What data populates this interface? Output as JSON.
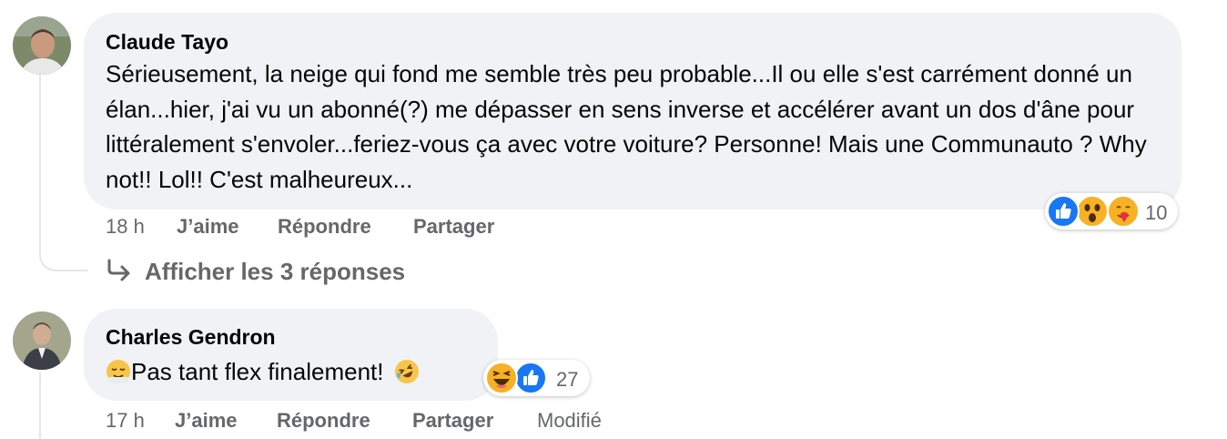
{
  "comments": [
    {
      "author": "Claude Tayo",
      "text": "Sérieusement, la neige qui fond me semble très peu probable...Il ou elle s'est carrément donné un élan...hier, j'ai vu un abonné(?) me dépasser en sens inverse et accélérer avant un dos d'âne pour littéralement s'envoler...feriez-vous ça avec votre voiture? Personne! Mais une Communauto ? Why not!! Lol!! C'est malheureux...",
      "time": "18 h",
      "like_label": "J’aime",
      "reply_label": "Répondre",
      "share_label": "Partager",
      "reactions": {
        "icons": [
          "like",
          "wow",
          "care"
        ],
        "count": "10"
      },
      "view_replies_label": "Afficher les 3 réponses"
    },
    {
      "author": "Charles Gendron",
      "text": "Pas tant flex finalement!",
      "emoji_before": "relieved-face-emoji",
      "emoji_after": "rolling-laughing-emoji",
      "time": "17 h",
      "like_label": "J’aime",
      "reply_label": "Répondre",
      "share_label": "Partager",
      "edited_label": "Modifié",
      "reactions": {
        "icons": [
          "haha",
          "like"
        ],
        "count": "27"
      }
    }
  ],
  "colors": {
    "bubble": "#f0f2f5",
    "meta_text": "#65676b",
    "like_blue": "#1877f2",
    "emoji_yellow": "#f7b125"
  }
}
